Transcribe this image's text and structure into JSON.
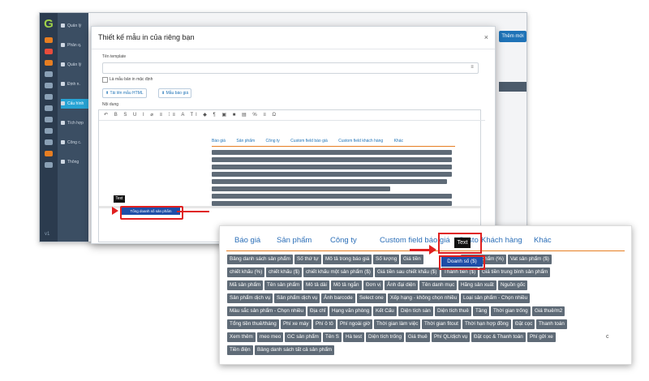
{
  "app": {
    "logo": "G",
    "version": "v1",
    "menu": [
      "Quản lý",
      "Phân q.",
      "Quản lý",
      "Định n.",
      "Cấu hình",
      "Tích hợp",
      "Công c.",
      "Thông"
    ],
    "add_button": "Thêm mới"
  },
  "modal": {
    "title": "Thiết kế mẫu in của riêng bạn",
    "close": "×",
    "template_label": "Tên template",
    "template_menu_icon": "≡",
    "default_checkbox": "Là mẫu bản in mặc định",
    "upload_html": "Tải lên mẫu HTML",
    "sample_button": "Mẫu báo giá",
    "content_label": "Nội dung",
    "toolbar": "↶ B S U I ⌀ ≡ ⁞≡ A Tl ◆ ¶ ▣ ■ ▤ % ≡ Ω",
    "tooltip_small": "Text",
    "highlighted_small": "Tổng doanh số sản phẩm",
    "small_tabs": [
      "Báo giá",
      "Sản phẩm",
      "Công ty",
      "Custom field báo giá",
      "Custom field khách hàng",
      "Khác"
    ]
  },
  "zoom": {
    "tabs": [
      "Báo giá",
      "Sản phẩm",
      "Công ty",
      "Custom field báo giá",
      "Custo",
      "Khách hàng",
      "Khác"
    ],
    "tooltip": "Text",
    "highlighted": "Doanh số ($)",
    "rows": [
      [
        "Bảng danh sách sản phẩm",
        "Số thứ tự",
        "Mô tả trong báo giá",
        "Số lượng",
        "Giá tiền",
        "Doanh số ($)",
        "Vat sản phẩm (%)",
        "Vat sản phẩm ($)"
      ],
      [
        "chiết khấu (%)",
        "chiết khấu ($)",
        "chiết khấu một sản phẩm ($)",
        "Giá tiền sau chiết khấu ($)",
        "Thành tiền ($)",
        "Giá tiền trung bình sản phẩm"
      ],
      [
        "Mã sản phẩm",
        "Tên sản phẩm",
        "Mô tả dài",
        "Mô tả ngắn",
        "Đơn vị",
        "Ảnh đại diện",
        "Tên danh mục",
        "Hãng sản xuất",
        "Nguồn gốc"
      ],
      [
        "Sản phẩm dịch vụ",
        "Sản phẩm dịch vụ",
        "Ảnh barcode",
        "Select one",
        "Xếp hạng - không chọn nhiều",
        "Loại sản phẩm - Chọn nhiều"
      ],
      [
        "Màu sắc sản phẩm - Chọn nhiều",
        "Địa chỉ",
        "Hạng văn phòng",
        "Kết Cấu",
        "Diện tích sàn",
        "Diện tích thuê",
        "Tầng",
        "Thời gian trống",
        "Giá thuê/m2"
      ],
      [
        "Tổng tiền thuê/tháng",
        "Phí xe máy",
        "Phí ô tô",
        "Phí ngoài giờ",
        "Thời gian làm việc",
        "Thời gian fitout",
        "Thời hạn hợp đồng",
        "Đặt cọc",
        "Thanh toán"
      ],
      [
        "Xem thêm",
        "meo meo",
        "GC sản phẩm",
        "Tên S",
        "Hà test",
        "Diện tích trống",
        "Giá thuê",
        "Phí QL/dịch vụ",
        "Đặt cọc & Thanh toán",
        "Phí gửi xe"
      ],
      [
        "Tiền điện",
        "Bảng danh sách tất cả sản phẩm"
      ]
    ],
    "side_char": "c"
  }
}
